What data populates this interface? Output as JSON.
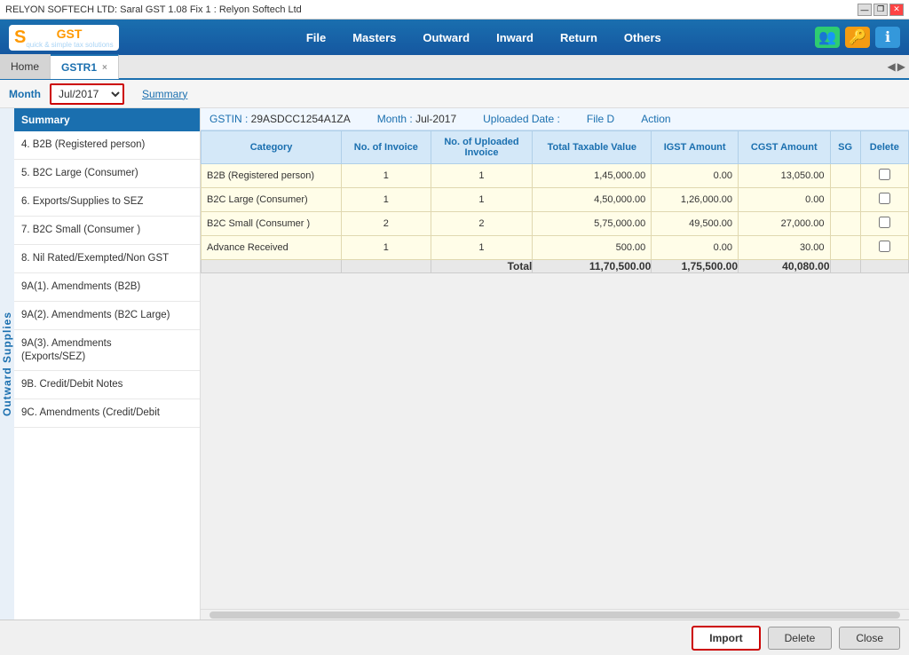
{
  "titleBar": {
    "text": "RELYON SOFTECH LTD: Saral GST 1.08 Fix 1 : Relyon Softech Ltd",
    "minimizeBtn": "—",
    "restoreBtn": "❐",
    "closeBtn": "✕"
  },
  "navbar": {
    "logo": "SaralGST",
    "logoSub": "quick & simple tax solutions",
    "menuItems": [
      "File",
      "Masters",
      "Outward",
      "Inward",
      "Return",
      "Others"
    ],
    "icons": {
      "people": "👥",
      "key": "🔑",
      "info": "ℹ"
    }
  },
  "tabs": {
    "homeLabel": "Home",
    "gstr1Label": "GSTR1",
    "closeBtn": "×",
    "navPrev": "◀",
    "navNext": "▶"
  },
  "monthBar": {
    "label": "Month",
    "selectedMonth": "Jul/2017",
    "summaryLink": "Summary"
  },
  "sidebar": {
    "header": "Summary",
    "stripLabel": "Outward Supplies",
    "items": [
      "4. B2B (Registered person)",
      "5. B2C Large (Consumer)",
      "6. Exports/Supplies to SEZ",
      "7. B2C Small (Consumer )",
      "8. Nil Rated/Exempted/Non GST",
      "9A(1). Amendments (B2B)",
      "9A(2). Amendments (B2C Large)",
      "9A(3). Amendments (Exports/SEZ)",
      "9B. Credit/Debit Notes",
      "9C. Amendments (Credit/Debit"
    ]
  },
  "infoBar": {
    "gstinLabel": "GSTIN :",
    "gstinValue": "29ASDCC1254A1ZA",
    "monthLabel": "Month :",
    "monthValue": "Jul-2017",
    "uploadedLabel": "Uploaded Date :",
    "uploadedValue": "",
    "fileLabel": "File D",
    "actionLabel": "Action"
  },
  "table": {
    "headers": [
      "Category",
      "No. of Invoice",
      "No. of Uploaded Invoice",
      "Total Taxable Value",
      "IGST Amount",
      "CGST Amount",
      "SG",
      "Delete"
    ],
    "rows": [
      {
        "category": "B2B (Registered person)",
        "noInvoice": "1",
        "noUploaded": "1",
        "totalTaxable": "1,45,000.00",
        "igst": "0.00",
        "cgst": "13,050.00",
        "sg": "",
        "delete": false
      },
      {
        "category": "B2C Large (Consumer)",
        "noInvoice": "1",
        "noUploaded": "1",
        "totalTaxable": "4,50,000.00",
        "igst": "1,26,000.00",
        "cgst": "0.00",
        "sg": "",
        "delete": false
      },
      {
        "category": "B2C Small (Consumer )",
        "noInvoice": "2",
        "noUploaded": "2",
        "totalTaxable": "5,75,000.00",
        "igst": "49,500.00",
        "cgst": "27,000.00",
        "sg": "",
        "delete": false
      },
      {
        "category": "Advance Received",
        "noInvoice": "1",
        "noUploaded": "1",
        "totalTaxable": "500.00",
        "igst": "0.00",
        "cgst": "30.00",
        "sg": "",
        "delete": false
      }
    ],
    "totalRow": {
      "label": "Total",
      "totalTaxable": "11,70,500.00",
      "igst": "1,75,500.00",
      "cgst": "40,080.00"
    }
  },
  "buttons": {
    "import": "Import",
    "delete": "Delete",
    "close": "Close"
  }
}
